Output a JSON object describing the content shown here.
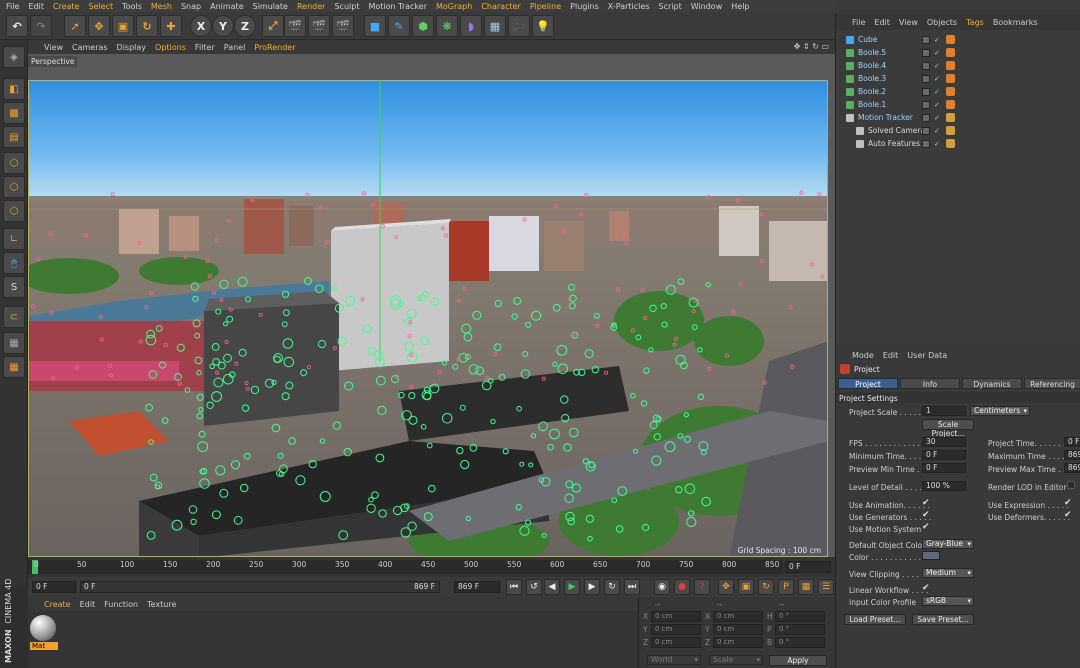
{
  "menubar": [
    "File",
    "Edit",
    "Create",
    "Select",
    "Tools",
    "Mesh",
    "Snap",
    "Animate",
    "Simulate",
    "Render",
    "Sculpt",
    "Motion Tracker",
    "MoGraph",
    "Character",
    "Pipeline",
    "Plugins",
    "X-Particles",
    "Script",
    "Window",
    "Help"
  ],
  "menubar_highlight": [
    "Create",
    "Select",
    "Mesh",
    "Render",
    "MoGraph",
    "Character",
    "Pipeline"
  ],
  "toolbar": {
    "x": "X",
    "y": "Y",
    "z": "Z"
  },
  "viewport": {
    "menu": [
      "View",
      "Cameras",
      "Display",
      "Options",
      "Filter",
      "Panel",
      "ProRender"
    ],
    "menu_highlight": [
      "Options",
      "ProRender"
    ],
    "label": "Perspective",
    "grid_spacing": "Grid Spacing : 100 cm"
  },
  "timeline": {
    "ticks": [
      "0",
      "50",
      "100",
      "150",
      "200",
      "250",
      "300",
      "350",
      "400",
      "450",
      "500",
      "550",
      "600",
      "650",
      "700",
      "750",
      "800",
      "850"
    ],
    "end_field": "0 F"
  },
  "transport": {
    "start": "0 F",
    "slider_start": "0 F",
    "slider_end": "869 F",
    "end": "869 F"
  },
  "material": {
    "menu": [
      "Create",
      "Edit",
      "Function",
      "Texture"
    ],
    "menu_highlight": [
      "Create"
    ],
    "name": "Mat"
  },
  "coords": {
    "header": [
      "--",
      "--",
      "--"
    ],
    "rows": [
      {
        "a": "X",
        "av": "0 cm",
        "b": "X",
        "bv": "0 cm",
        "c": "H",
        "cv": "0 °"
      },
      {
        "a": "Y",
        "av": "0 cm",
        "b": "Y",
        "bv": "0 cm",
        "c": "P",
        "cv": "0 °"
      },
      {
        "a": "Z",
        "av": "0 cm",
        "b": "Z",
        "bv": "0 cm",
        "c": "B",
        "cv": "0 °"
      }
    ],
    "world": "World",
    "scale": "Scale",
    "apply": "Apply"
  },
  "brand": {
    "line1": "MAXON",
    "line2": "CINEMA 4D"
  },
  "objects": {
    "menu": [
      "File",
      "Edit",
      "View",
      "Objects",
      "Tags",
      "Bookmarks"
    ],
    "menu_highlight": [
      "Tags"
    ],
    "items": [
      {
        "name": "Cube",
        "indent": 0
      },
      {
        "name": "Boole.5",
        "indent": 0
      },
      {
        "name": "Boole.4",
        "indent": 0
      },
      {
        "name": "Boole.3",
        "indent": 0
      },
      {
        "name": "Boole.2",
        "indent": 0
      },
      {
        "name": "Boole.1",
        "indent": 0
      },
      {
        "name": "Motion Tracker",
        "indent": 0
      },
      {
        "name": "Solved Camera",
        "indent": 1
      },
      {
        "name": "Auto Features",
        "indent": 1
      }
    ]
  },
  "attributes": {
    "menu": [
      "Mode",
      "Edit",
      "User Data"
    ],
    "title": "Project",
    "tabs": [
      "Project Settings",
      "Info",
      "Dynamics",
      "Referencing"
    ],
    "section": "Project Settings",
    "project_scale_label": "Project Scale . . . . . .",
    "project_scale_value": "1",
    "project_scale_unit": "Centimeters",
    "scale_project_btn": "Scale Project...",
    "fps_label": "FPS . . . . . . . . . . . . . .",
    "fps": "30",
    "project_time_label": "Project Time. . . . . . .",
    "project_time": "0 F",
    "min_time_label": "Minimum Time. . . . . . .",
    "min_time": "0 F",
    "max_time_label": "Maximum Time . . . . . .",
    "max_time": "869",
    "prev_min_label": "Preview Min Time . . .",
    "prev_min": "0 F",
    "prev_max_label": "Preview Max Time . . .",
    "prev_max": "869",
    "lod_label": "Level of Detail . . . . . .",
    "lod": "100 %",
    "render_lod_label": "Render LOD in Editor",
    "use_anim_label": "Use Animation. . . . . .",
    "use_expr_label": "Use Expression . . . . .",
    "use_gen_label": "Use Generators . . . . .",
    "use_def_label": "Use Deformers. . . . . .",
    "use_motion_label": "Use Motion System",
    "default_color_label": "Default Object Color",
    "default_color": "Gray-Blue",
    "color_label": "Color . . . . . . . . . . . .",
    "view_clip_label": "View Clipping . . . . . .",
    "view_clip": "Medium",
    "linear_label": "Linear Workflow . . . .",
    "input_profile_label": "Input Color Profile",
    "input_profile": "sRGB",
    "load_preset": "Load Preset...",
    "save_preset": "Save Preset..."
  },
  "colors": {
    "accent": "#f0b030",
    "tab_active": "#3b5f8f",
    "tracker_green": "#40ff90",
    "object_blue": "#9cd4ff"
  }
}
